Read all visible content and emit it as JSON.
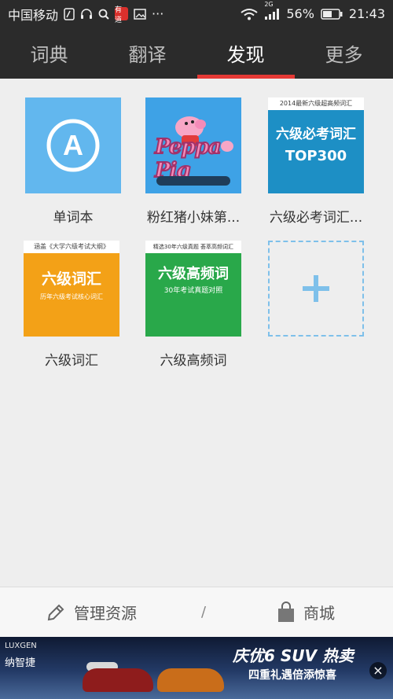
{
  "status_bar": {
    "carrier": "中国移动",
    "notification_badge": "有道",
    "network": "2G",
    "battery_percent": "56%",
    "time": "21:43",
    "overflow": "···"
  },
  "nav": {
    "tabs": [
      {
        "label": "词典",
        "active": false
      },
      {
        "label": "翻译",
        "active": false
      },
      {
        "label": "发现",
        "active": true
      },
      {
        "label": "更多",
        "active": false
      }
    ]
  },
  "grid": {
    "items": [
      {
        "label": "单词本",
        "thumb_letter": "A"
      },
      {
        "label": "粉红猪小妹第...",
        "thumb_text": "Peppa Pig"
      },
      {
        "label": "六级必考词汇...",
        "thumb_top": "2014最新六级超高频词汇",
        "thumb_title": "六级必考词汇",
        "thumb_sub": "TOP300"
      },
      {
        "label": "六级词汇",
        "thumb_top": "涵盖《大学六级考试大纲》",
        "thumb_title": "六级词汇",
        "thumb_sub": "历年六级考试核心词汇"
      },
      {
        "label": "六级高频词",
        "thumb_top": "精选30年六级真题 荟萃高频词汇",
        "thumb_title": "六级高频词",
        "thumb_sub": "30年考试真题对照"
      },
      {
        "label": "",
        "add": true
      }
    ]
  },
  "bottom_bar": {
    "manage_label": "管理资源",
    "separator": "/",
    "store_label": "商城"
  },
  "ad": {
    "brand_en": "LUXGEN",
    "brand_cn": "纳智捷",
    "headline": "庆优6 SUV 热卖",
    "subline": "四重礼遇倍添惊喜",
    "close": "×"
  },
  "colors": {
    "header_bg": "#2b2b2b",
    "active_indicator": "#e53935",
    "accent_blue": "#62b7ee"
  }
}
